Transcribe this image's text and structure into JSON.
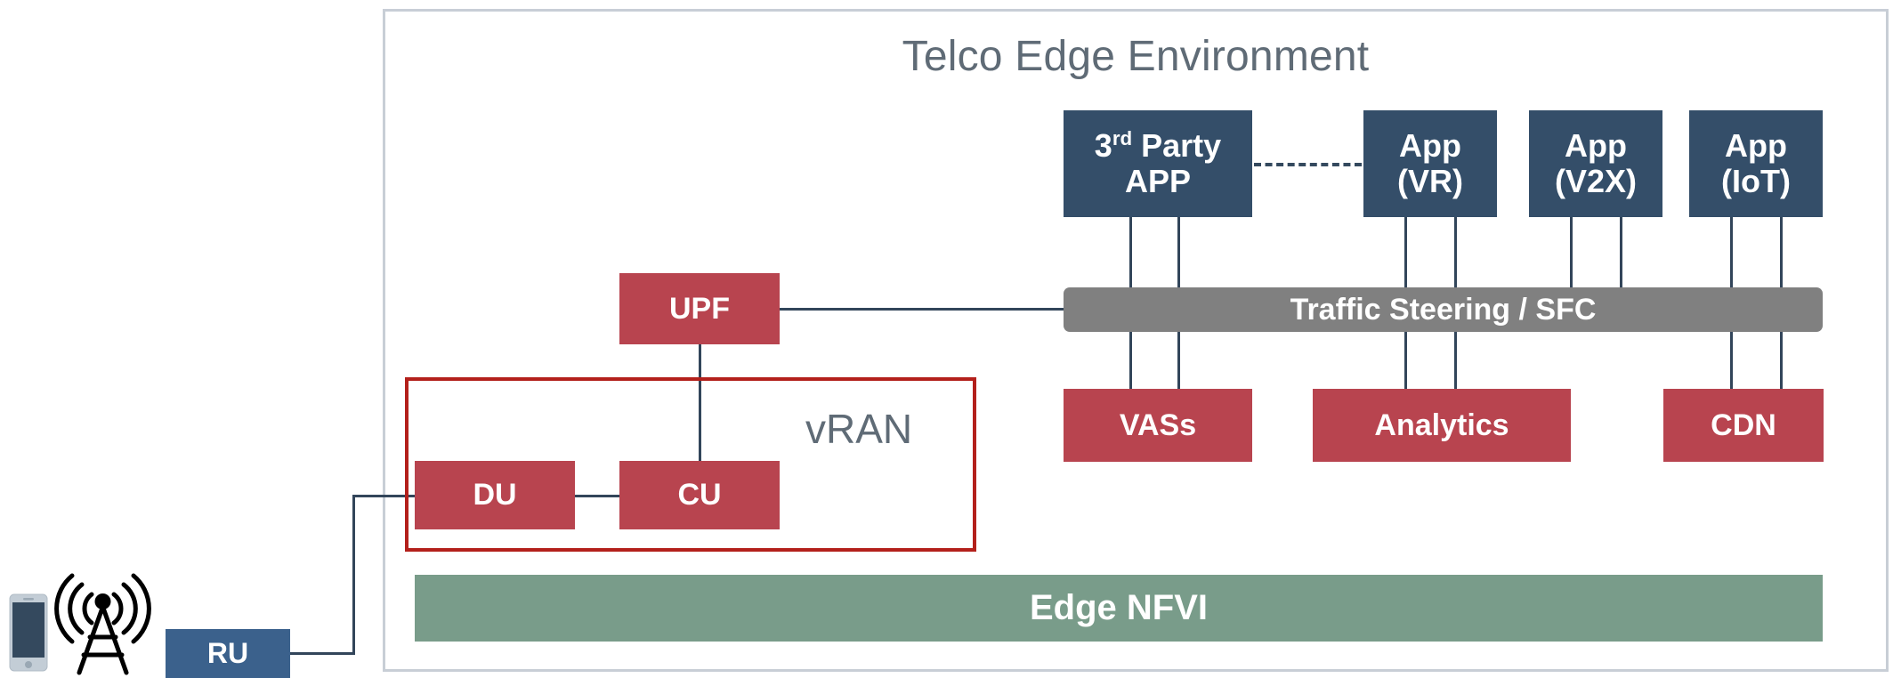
{
  "diagram": {
    "title": "Telco Edge Environment",
    "vran_label": "vRAN",
    "traffic_bar_label": "Traffic Steering / SFC",
    "nfvi_label": "Edge NFVI",
    "colors": {
      "navy": "#344e69",
      "red": "#b8444f",
      "blue": "#3b618c",
      "gray": "#808080",
      "green": "#799c8a",
      "vran_border": "#b3201b",
      "frame_border": "#c8ced6",
      "text_gray": "#5f6b76",
      "line": "#32455a"
    },
    "apps": [
      {
        "id": "app-3rd",
        "line1": "3",
        "sup": "rd",
        "line1_rest": " Party",
        "line2": "APP",
        "full": "3rd Party APP"
      },
      {
        "id": "app-vr",
        "line1": "App",
        "line2": "(VR)",
        "full": "App (VR)"
      },
      {
        "id": "app-v2x",
        "line1": "App",
        "line2": "(V2X)",
        "full": "App (V2X)"
      },
      {
        "id": "app-iot",
        "line1": "App",
        "line2": "(IoT)",
        "full": "App (IoT)"
      }
    ],
    "services": [
      {
        "id": "svc-vass",
        "label": "VASs"
      },
      {
        "id": "svc-analytics",
        "label": "Analytics"
      },
      {
        "id": "svc-cdn",
        "label": "CDN"
      }
    ],
    "core": {
      "upf": "UPF",
      "du": "DU",
      "cu": "CU",
      "ru": "RU"
    },
    "icons": {
      "phone": "smartphone-icon",
      "tower": "cell-tower-icon"
    }
  }
}
